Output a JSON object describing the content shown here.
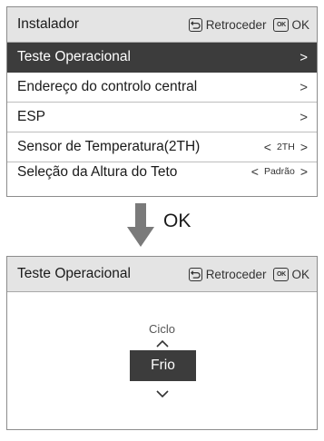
{
  "screen1": {
    "title": "Instalador",
    "back_label": "Retroceder",
    "ok_icon_text": "OK",
    "ok_label": "OK",
    "rows": [
      {
        "label": "Teste Operacional",
        "chevron": ">"
      },
      {
        "label": "Endereço do controlo central",
        "chevron": ">"
      },
      {
        "label": "ESP",
        "chevron": ">"
      },
      {
        "label": "Sensor de Temperatura(2TH)",
        "prev": "<",
        "value": "2TH",
        "next": ">"
      },
      {
        "label": "Seleção da Altura do Teto",
        "prev": "<",
        "value": "Padrão",
        "next": ">"
      }
    ]
  },
  "transition": {
    "label": "OK"
  },
  "screen2": {
    "title": "Teste Operacional",
    "back_label": "Retroceder",
    "ok_icon_text": "OK",
    "ok_label": "OK",
    "setting_label": "Ciclo",
    "setting_value": "Frio"
  },
  "icons": [
    "back-icon",
    "ok-key-icon",
    "chevron-right-icon",
    "chevron-left-icon",
    "arrow-down-icon",
    "caret-up-icon",
    "caret-down-icon"
  ],
  "colors": {
    "header_bg": "#e4e4e4",
    "selected_bg": "#3c3c3c",
    "arrow": "#7a7a7a"
  }
}
